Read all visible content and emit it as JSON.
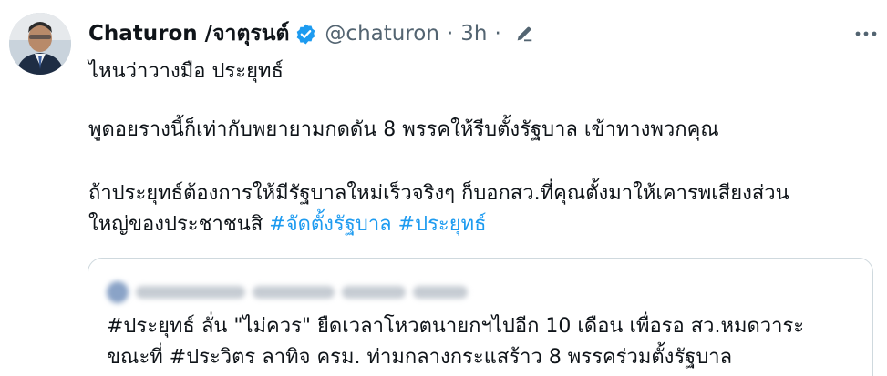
{
  "tweet": {
    "author": {
      "display_name": "Chaturon /จาตุรนต์",
      "handle": "@chaturon",
      "time": "3h",
      "separator": "·",
      "verified": true
    },
    "lines": {
      "l1": "ไหนว่าวางมือ ประยุทธ์",
      "l2": "พูดอยรางนี้ก็เท่ากับพยายามกดดัน 8 พรรคให้รีบตั้งรัฐบาล เข้าทางพวกคุณ",
      "l3": "ถ้าประยุทธ์ต้องการให้มีรัฐบาลใหม่เร็วจริงๆ ก็บอกสว.ที่คุณตั้งมาให้เคารพเสียงส่วน",
      "l4_text": "ใหญ่ของประชาชนสิ ",
      "l4_tag1": "#จัดตั้งรัฐบาล",
      "l4_tag2": "#ประยุทธ์"
    },
    "quote": {
      "line1": "#ประยุทธ์ ลั่น \"ไม่ควร\" ยืดเวลาโหวตนายกฯไปอีก 10 เดือน เพื่อรอ สว.หมดวาระ",
      "line2": "ขณะที่ #ประวิตร ลาทิจ ครม. ท่ามกลางกระแสร้าว 8 พรรคร่วมตั้งรัฐบาล"
    }
  },
  "icons": {
    "verified": "verified-badge-icon",
    "edit": "edit-pencil-icon",
    "more": "more-options-icon"
  },
  "colors": {
    "link": "#1d9bf0",
    "muted": "#536471",
    "text": "#0f1419",
    "border": "#cfd9de"
  }
}
